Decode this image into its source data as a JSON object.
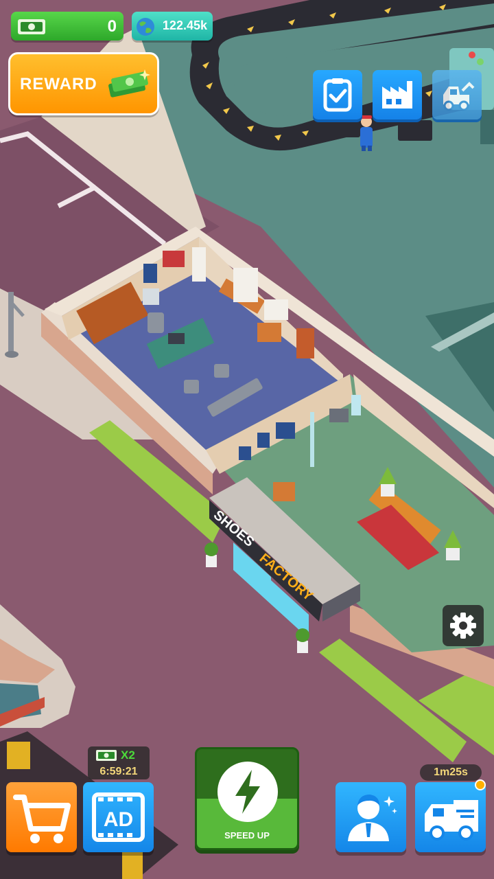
{
  "hud": {
    "cash_value": "0",
    "gems_value": "122.45k",
    "reward_label": "REWARD"
  },
  "top_buttons": [
    {
      "icon": "task-checklist-icon"
    },
    {
      "icon": "factory-icon"
    },
    {
      "icon": "forklift-truck-icon"
    }
  ],
  "building_sign": {
    "word1": "SHOES",
    "word2": "FACTORY"
  },
  "bottom": {
    "boost_multiplier": "X2",
    "boost_timer": "6:59:21",
    "ad_label": "AD",
    "speed_up_label": "SPEED UP",
    "truck_timer": "1m25s"
  },
  "colors": {
    "cash_green": "#2ea82a",
    "gem_teal": "#1fb5a6",
    "reward_orange": "#ff9500",
    "button_blue": "#1582e8",
    "shop_orange": "#ff7a00",
    "speed_green": "#58b93a",
    "road_mauve": "#8a5a6f",
    "floor_teal": "#5c8d86"
  }
}
